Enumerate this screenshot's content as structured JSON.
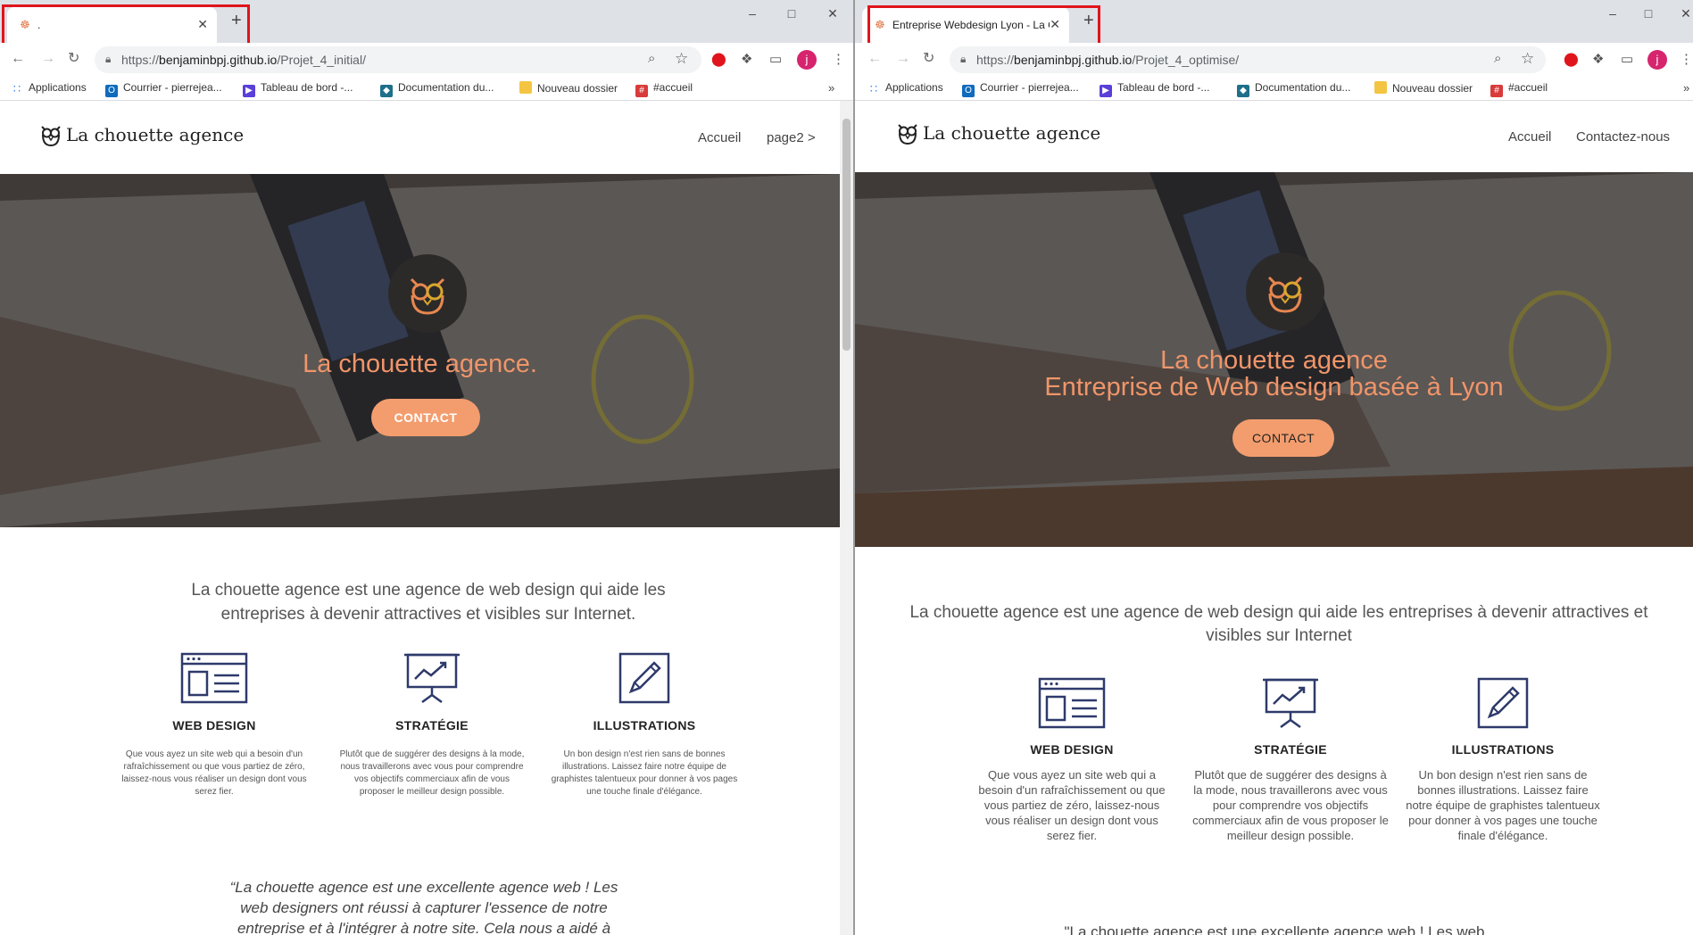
{
  "left": {
    "tab_title": ".",
    "url_prefix": "https://",
    "url_host": "benjaminbpj.github.io",
    "url_path": "/Projet_4_initial/",
    "logo_text": "La chouette agence",
    "nav": [
      "Accueil",
      "page2 >"
    ],
    "hero_title": "La chouette agence.",
    "cta": "CONTACT",
    "intro": "La chouette agence est une agence de web design qui aide les entreprises à devenir attractives et visibles sur Internet.",
    "services": [
      {
        "title": "WEB DESIGN",
        "text": "Que vous ayez un site web qui a besoin d'un rafraîchissement ou que vous partiez de zéro, laissez-nous vous réaliser un design dont vous serez fier."
      },
      {
        "title": "STRATÉGIE",
        "text": "Plutôt que de suggérer des designs à la mode, nous travaillerons avec vous pour comprendre vos objectifs commerciaux afin de vous proposer le meilleur design possible."
      },
      {
        "title": "ILLUSTRATIONS",
        "text": "Un bon design n'est rien sans de bonnes illustrations. Laissez faire notre équipe de graphistes talentueux pour donner à vos pages une touche finale d'élégance."
      }
    ],
    "quote": "“La chouette agence est une excellente agence web ! Les web designers ont réussi à capturer l'essence de notre entreprise et à l'intégrer à notre site. Cela nous a aidé à"
  },
  "right": {
    "tab_title": "Entreprise Webdesign Lyon - La C",
    "url_prefix": "https://",
    "url_host": "benjaminbpj.github.io",
    "url_path": "/Projet_4_optimise/",
    "logo_text": "La chouette agence",
    "nav": [
      "Accueil",
      "Contactez-nous"
    ],
    "hero_title_1": "La chouette agence",
    "hero_title_2": "Entreprise de Web design basée à Lyon",
    "cta": "CONTACT",
    "intro": "La chouette agence est une agence de web design qui aide les entreprises à devenir attractives et visibles sur Internet",
    "services": [
      {
        "title": "WEB DESIGN",
        "text": "Que vous ayez un site web qui a besoin d'un rafraîchissement ou que vous partiez de zéro, laissez-nous vous réaliser un design dont vous serez fier."
      },
      {
        "title": "STRATÉGIE",
        "text": "Plutôt que de suggérer des designs à la mode, nous travaillerons avec vous pour comprendre vos objectifs commerciaux afin de vous proposer le meilleur design possible."
      },
      {
        "title": "ILLUSTRATIONS",
        "text": "Un bon design n'est rien sans de bonnes illustrations. Laissez faire notre équipe de graphistes talentueux pour donner à vos pages une touche finale d'élégance."
      }
    ],
    "quote": "\"La chouette agence est une excellente agence web ! Les web"
  },
  "bookmarks": [
    {
      "label": "Applications",
      "icon": "apps-grid-icon",
      "color": "#4285f4"
    },
    {
      "label": "Courrier - pierrejea...",
      "icon": "outlook-icon",
      "color": "#0f6cbd"
    },
    {
      "label": "Tableau de bord -...",
      "icon": "dashboard-icon",
      "color": "#5a3fd9"
    },
    {
      "label": "Documentation du...",
      "icon": "docs-icon",
      "color": "#1f6f8b"
    },
    {
      "label": "Nouveau dossier",
      "icon": "folder-icon",
      "color": "#f4c542"
    },
    {
      "label": "#accueil",
      "icon": "slack-icon",
      "color": "#d93b3b"
    }
  ],
  "more_bookmarks": "»",
  "avatar_letter": "j",
  "colors": {
    "accent": "#f39d6e",
    "hero_text": "#f0956a",
    "highlight": "#e0141c",
    "icon_stroke": "#2e3a6b"
  }
}
